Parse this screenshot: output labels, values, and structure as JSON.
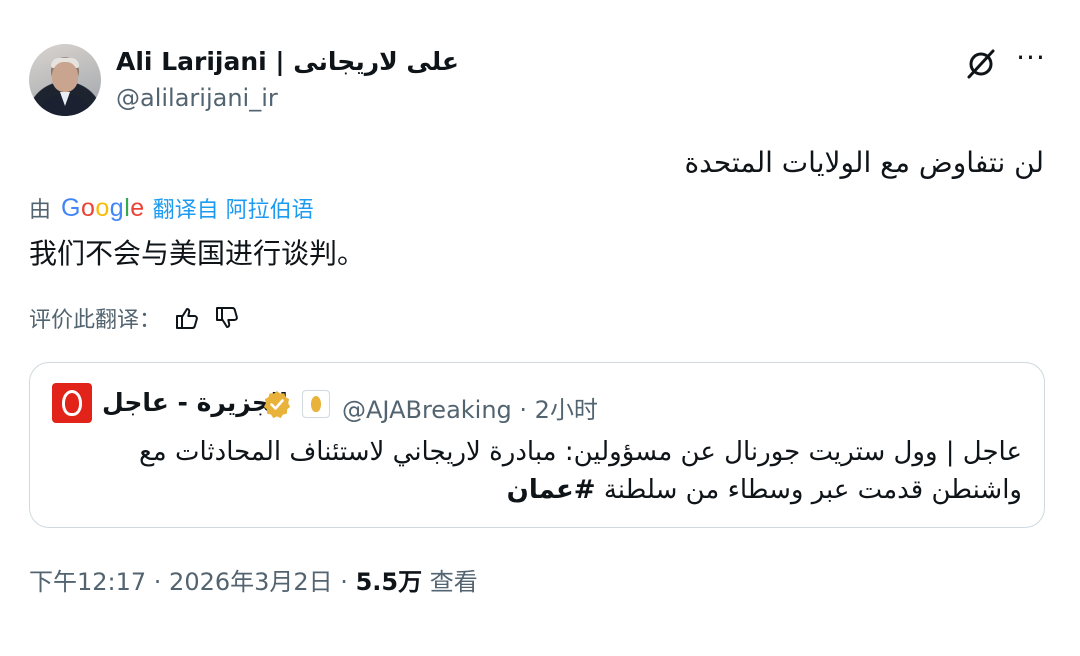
{
  "author": {
    "display_name": "Ali Larijani | علی لاریجانی",
    "handle": "@alilarijani_ir"
  },
  "tweet": {
    "text_original": "لن نتفاوض مع الولايات المتحدة",
    "translated_by_prefix": "由",
    "translated_by_brand": "Google",
    "translated_by_suffix": "翻译自 阿拉伯语",
    "text_translated": "我们不会与美国进行谈判。",
    "rate_translation_label": "评价此翻译："
  },
  "quote": {
    "account_name": "الجزيرة - عاجل",
    "handle_and_time": "@AJABreaking · 2小时",
    "text": "عاجل | وول ستريت جورنال عن مسؤولين: مبادرة لاريجاني لاستئناف المحادثات مع واشنطن قدمت عبر وسطاء من سلطنة",
    "hashtag": "#عمان",
    "logo_color": "#e2231a"
  },
  "meta": {
    "time_date": "下午12:17 · 2026年3月2日 · ",
    "views_count": "5.5万",
    "views_label": " 查看"
  },
  "icons": {
    "grok": "grok-icon",
    "more": "more-icon",
    "thumbs_up": "thumbs-up-icon",
    "thumbs_down": "thumbs-down-icon",
    "verified": "verified-badge-icon"
  },
  "colors": {
    "accent": "#1d9bf0",
    "verified_gold": "#e8b23b",
    "secondary_text": "#536471"
  }
}
